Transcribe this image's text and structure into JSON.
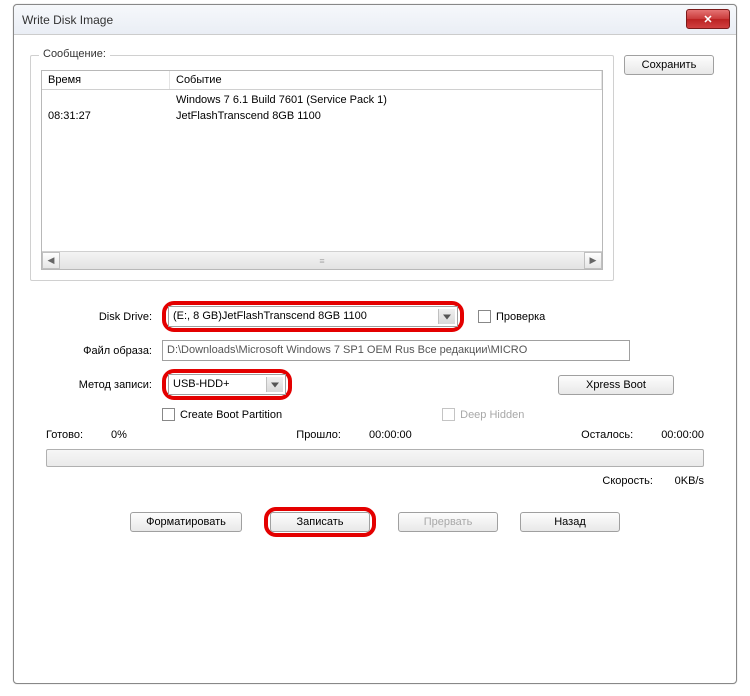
{
  "window": {
    "title": "Write Disk Image"
  },
  "topButtons": {
    "save": "Сохранить"
  },
  "messageGroup": {
    "label": "Сообщение:"
  },
  "listView": {
    "cols": {
      "time": "Время",
      "event": "Событие"
    },
    "rows": [
      {
        "time": "",
        "event": "Windows 7 6.1 Build 7601 (Service Pack 1)"
      },
      {
        "time": "08:31:27",
        "event": "JetFlashTranscend 8GB  1100"
      }
    ]
  },
  "fields": {
    "diskDrive": {
      "label": "Disk Drive:",
      "value": "(E:, 8 GB)JetFlashTranscend 8GB  1100"
    },
    "verify": {
      "label": "Проверка"
    },
    "imageFile": {
      "label": "Файл образа:",
      "value": "D:\\Downloads\\Microsoft Windows 7 SP1 OEM Rus Все редакции\\MICRO"
    },
    "writeMethod": {
      "label": "Метод записи:",
      "value": "USB-HDD+"
    },
    "xpressBoot": {
      "label": "Xpress Boot"
    },
    "createBoot": {
      "label": "Create Boot Partition"
    },
    "deepHidden": {
      "label": "Deep Hidden"
    }
  },
  "status": {
    "ready": "Готово:",
    "readyVal": "0%",
    "elapsed": "Прошло:",
    "elapsedVal": "00:00:00",
    "remain": "Осталось:",
    "remainVal": "00:00:00",
    "speed": "Скорость:",
    "speedVal": "0KB/s"
  },
  "buttons": {
    "format": "Форматировать",
    "write": "Записать",
    "abort": "Прервать",
    "back": "Назад"
  }
}
